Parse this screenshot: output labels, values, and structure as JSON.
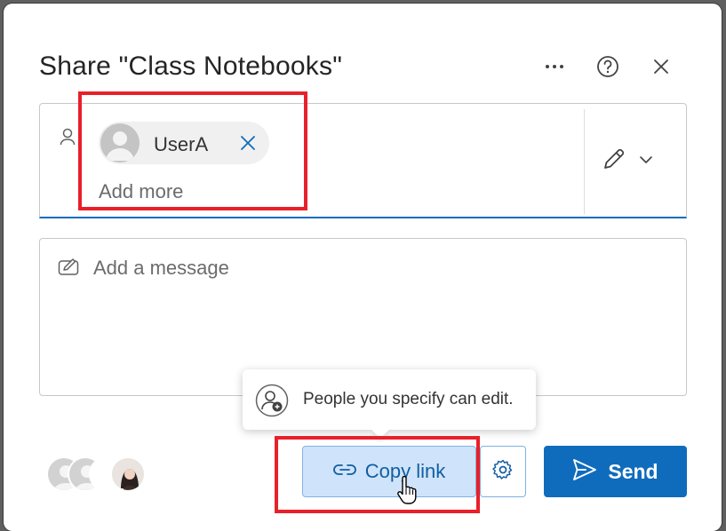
{
  "dialog": {
    "title": "Share \"Class Notebooks\"",
    "header_icons": [
      "more-options-icon",
      "help-icon",
      "close-icon"
    ]
  },
  "recipients": {
    "chip": {
      "name": "UserA",
      "remove_icon": "close-icon"
    },
    "placeholder": "Add more",
    "permission_icon": "pencil-icon"
  },
  "message": {
    "placeholder": "Add a message"
  },
  "tooltip": {
    "text": "People you specify can edit."
  },
  "actions": {
    "copy_link_label": "Copy link",
    "send_label": "Send"
  },
  "colors": {
    "accent": "#0f6cbd",
    "copy_link_bg": "#cfe4fa",
    "highlight": "#e8202a"
  }
}
